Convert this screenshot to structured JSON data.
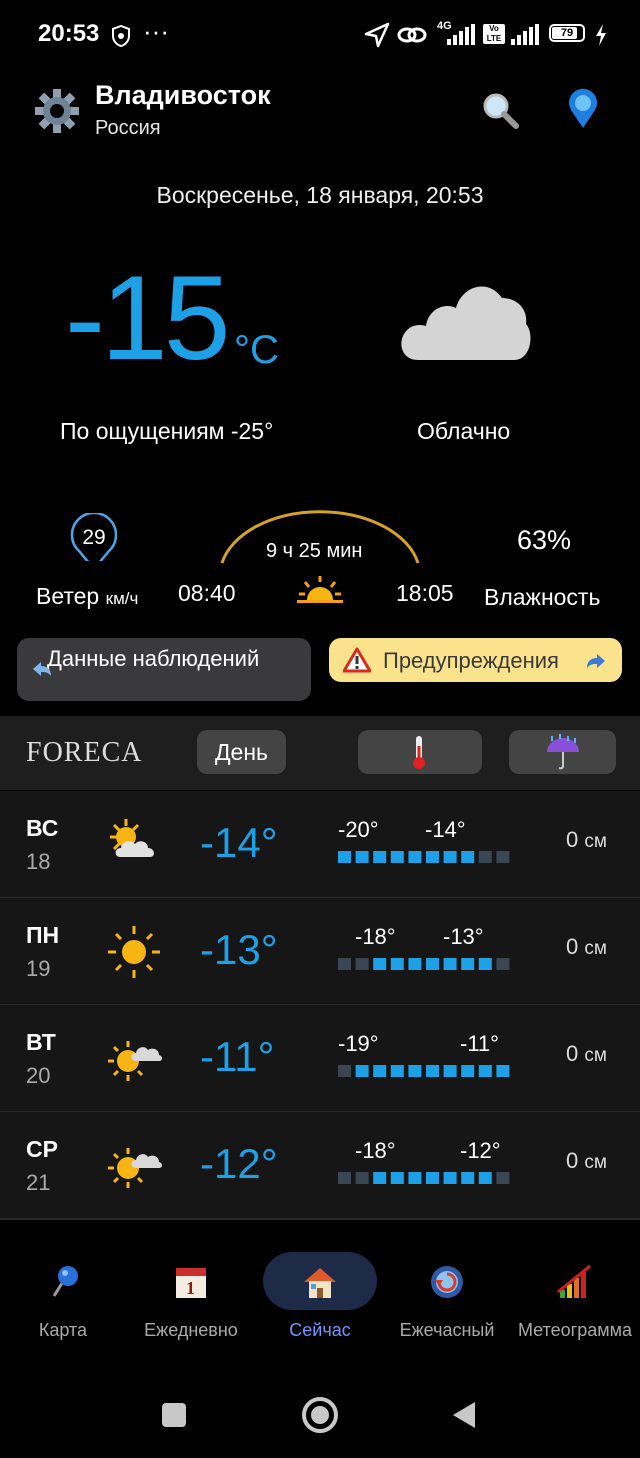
{
  "status_bar": {
    "time": "20:53",
    "dots": "···",
    "net_label": "4G",
    "volte": "Vo LTE",
    "battery": "79"
  },
  "header": {
    "city": "Владивосток",
    "country": "Россия",
    "settings_icon": "gear-icon",
    "search_icon": "search-icon",
    "location_icon": "location-pin-icon"
  },
  "now": {
    "datetime": "Воскресенье, 18 января, 20:53",
    "temperature": "-15",
    "unit": "°C",
    "feels_like": "По ощущениям -25°",
    "condition": "Облачно",
    "wind_speed": "29",
    "wind_label": "Ветер",
    "wind_unit": "км/ч",
    "sunrise": "08:40",
    "sunset": "18:05",
    "day_length": "9 ч 25 мин",
    "humidity": "63%",
    "humidity_label": "Влажность"
  },
  "buttons": {
    "observations": "Данные наблюдений",
    "warnings": "Предупреждения"
  },
  "forecast_header": {
    "brand": "FORECA",
    "day_tab": "День"
  },
  "forecast": [
    {
      "day": "ВС",
      "date": "18",
      "icon": "partly-cloudy-icon",
      "temp": "-14°",
      "low": "-20°",
      "high": "-14°",
      "precip": "0",
      "precip_unit": "см",
      "bar_start": 0,
      "bar_end": 7
    },
    {
      "day": "ПН",
      "date": "19",
      "icon": "sunny-icon",
      "temp": "-13°",
      "low": "-18°",
      "high": "-13°",
      "precip": "0",
      "precip_unit": "см",
      "bar_start": 2,
      "bar_end": 8
    },
    {
      "day": "ВТ",
      "date": "20",
      "icon": "sun-cloud-icon",
      "temp": "-11°",
      "low": "-19°",
      "high": "-11°",
      "precip": "0",
      "precip_unit": "см",
      "bar_start": 1,
      "bar_end": 9
    },
    {
      "day": "СР",
      "date": "21",
      "icon": "sun-cloud-icon",
      "temp": "-12°",
      "low": "-18°",
      "high": "-12°",
      "precip": "0",
      "precip_unit": "см",
      "bar_start": 2,
      "bar_end": 8
    }
  ],
  "nav": [
    {
      "label": "Карта",
      "icon": "map-pin-icon"
    },
    {
      "label": "Ежедневно",
      "icon": "calendar-icon"
    },
    {
      "label": "Сейчас",
      "icon": "home-icon"
    },
    {
      "label": "Ежечасный",
      "icon": "clock-arrow-icon"
    },
    {
      "label": "Метеограмма",
      "icon": "graph-icon"
    }
  ],
  "colors": {
    "accent": "#1ea0e6",
    "warning_bg": "#fbe38e",
    "nav_active": "#6e98ff"
  }
}
